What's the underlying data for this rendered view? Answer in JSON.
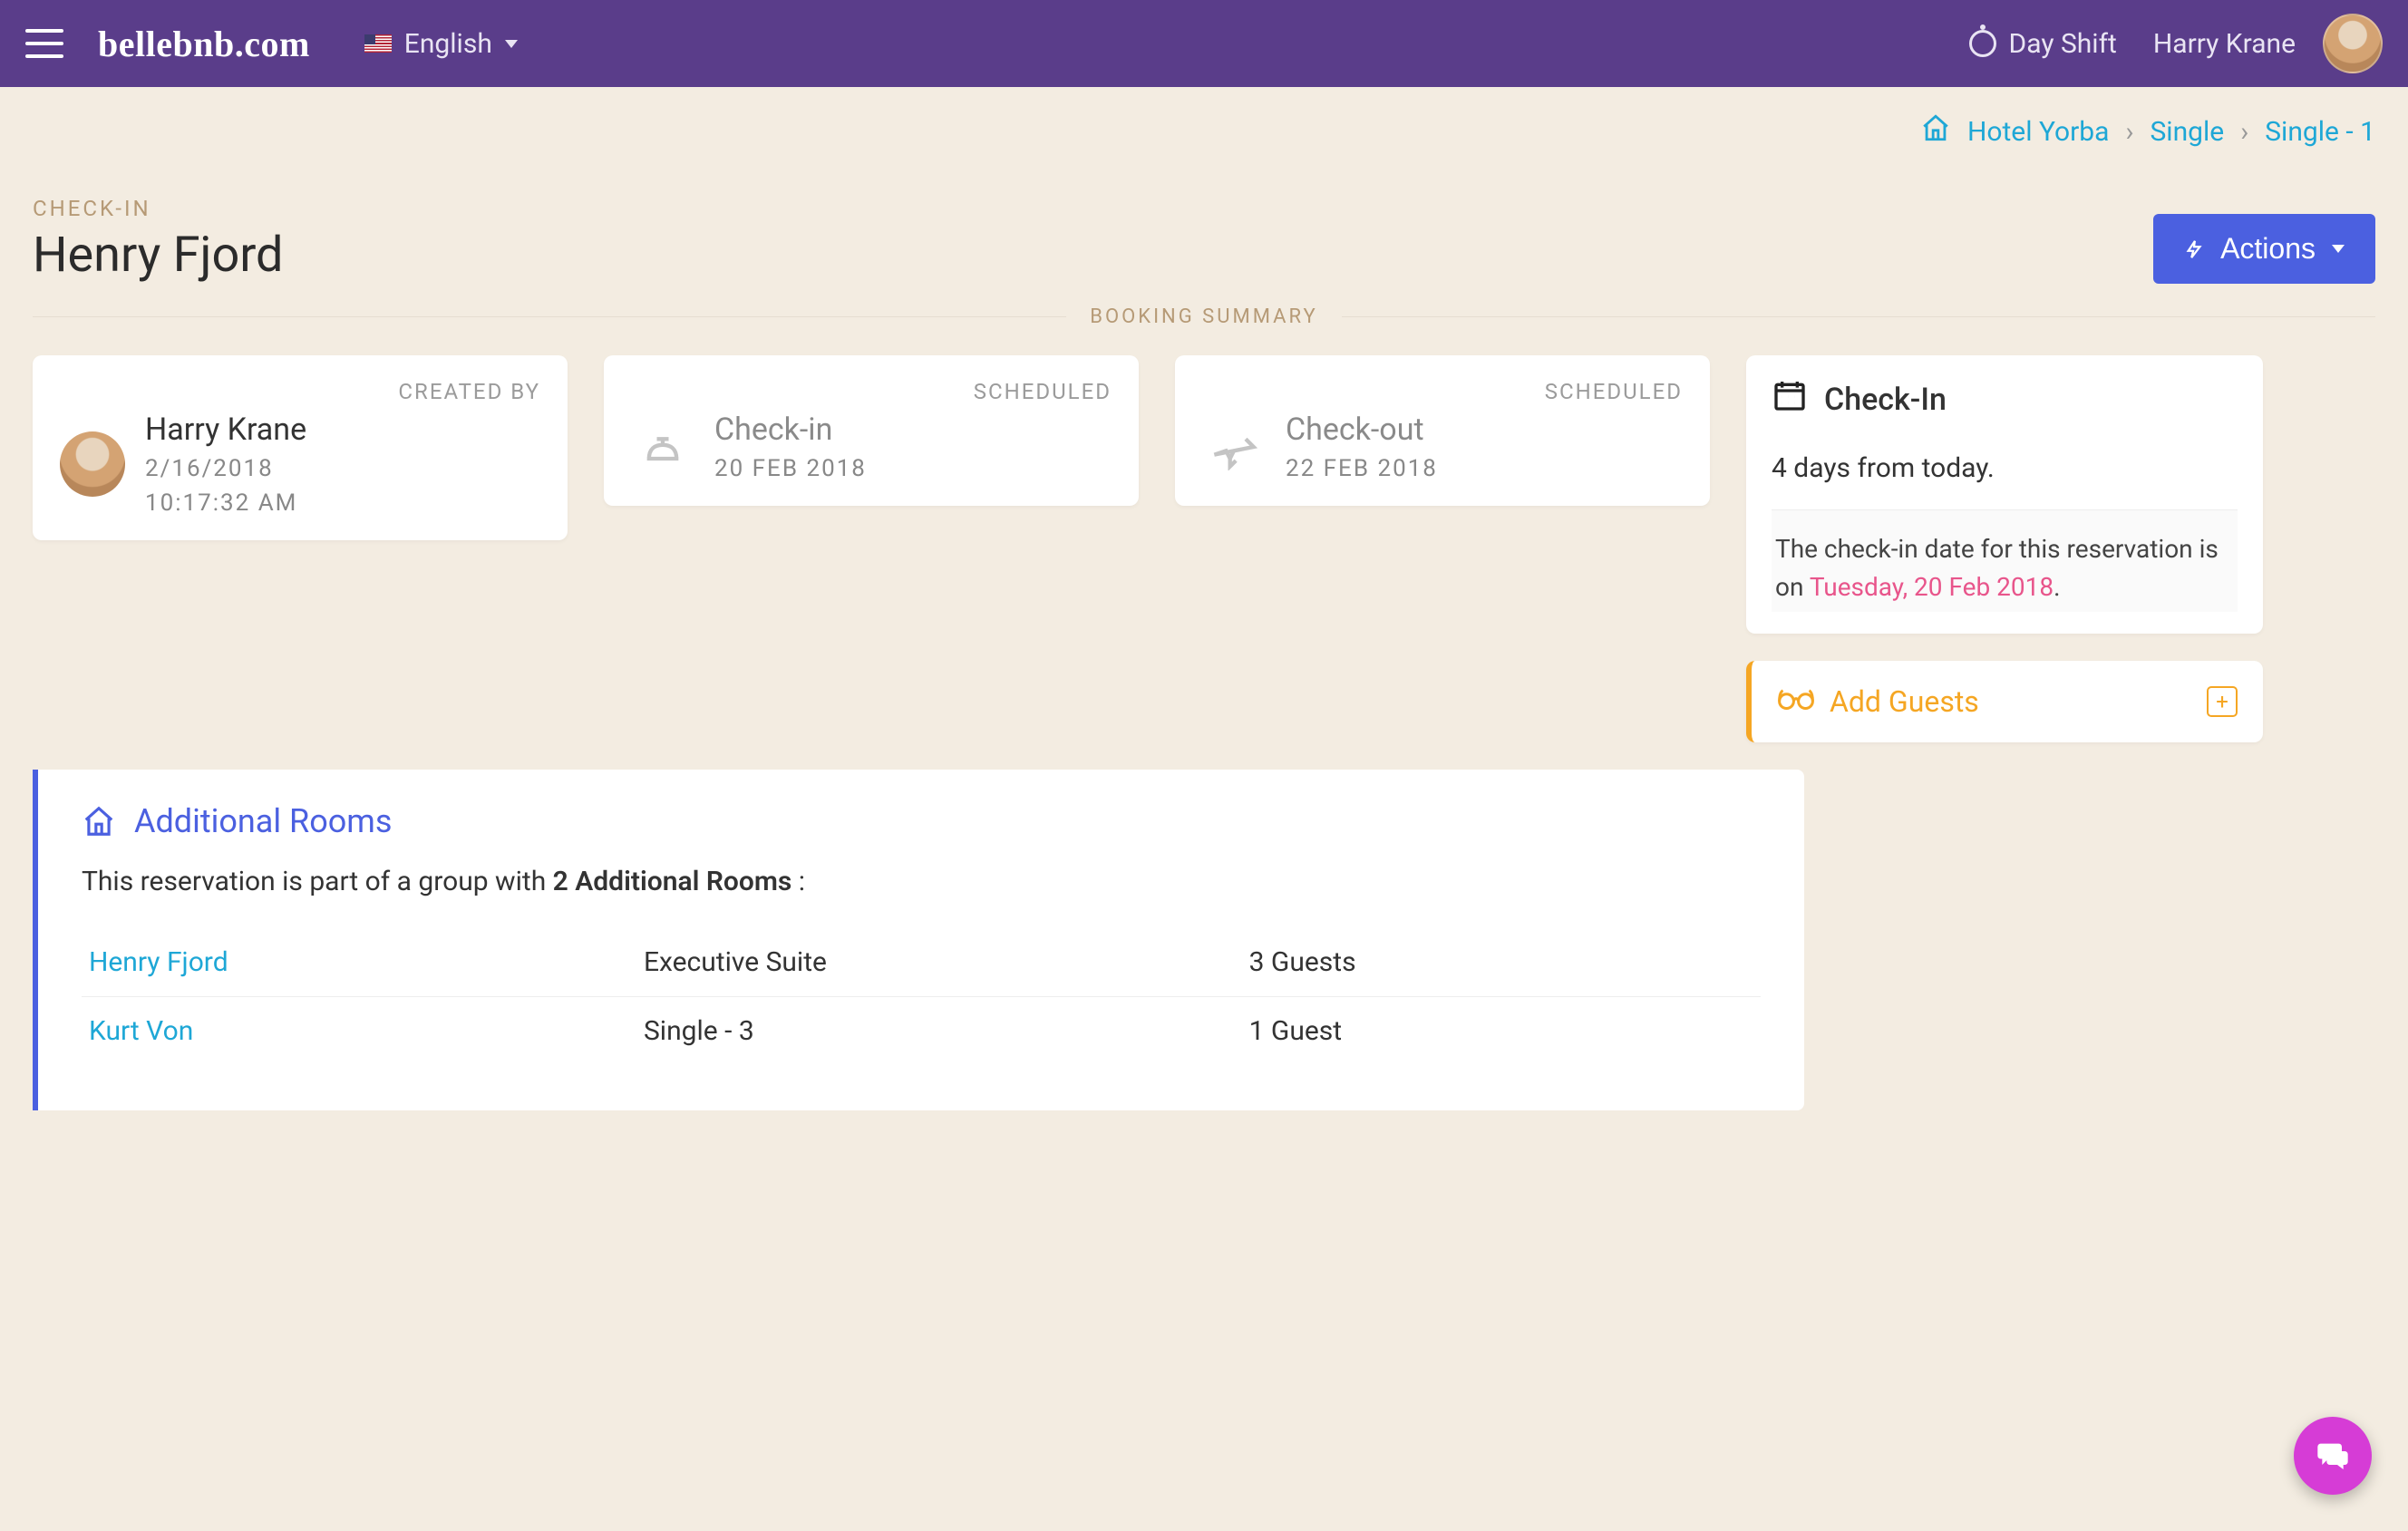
{
  "colors": {
    "accent_purple": "#5a3d8a",
    "accent_blue": "#4b60e0",
    "accent_cyan": "#1ea7d6",
    "accent_orange": "#f5a623",
    "accent_pink": "#e8558b"
  },
  "header": {
    "brand": "bellebnb.com",
    "language": "English",
    "shift": "Day Shift",
    "user": "Harry Krane"
  },
  "breadcrumb": {
    "items": [
      "Hotel Yorba",
      "Single",
      "Single - 1"
    ]
  },
  "title": {
    "label": "CHECK-IN",
    "guest": "Henry Fjord",
    "actions_label": "Actions"
  },
  "section_label": "BOOKING SUMMARY",
  "cards": {
    "created": {
      "tag": "CREATED BY",
      "name": "Harry Krane",
      "date": "2/16/2018",
      "time": "10:17:32 AM"
    },
    "checkin": {
      "tag": "SCHEDULED",
      "name": "Check-in",
      "date": "20 FEB 2018"
    },
    "checkout": {
      "tag": "SCHEDULED",
      "name": "Check-out",
      "date": "22 FEB 2018"
    }
  },
  "checkin_box": {
    "title": "Check-In",
    "lead": "4 days from today.",
    "note_pre": "The check-in date for this reservation is on ",
    "note_date": "Tuesday, 20 Feb 2018",
    "note_post": "."
  },
  "add_guests": {
    "label": "Add Guests"
  },
  "rooms": {
    "title": "Additional Rooms",
    "desc_pre": "This reservation is part of a group with ",
    "desc_bold": "2 Additional Rooms",
    "desc_post": " :",
    "rows": [
      {
        "guest": "Henry Fjord",
        "room": "Executive Suite",
        "guests": "3 Guests"
      },
      {
        "guest": "Kurt Von",
        "room": "Single - 3",
        "guests": "1 Guest"
      }
    ]
  }
}
